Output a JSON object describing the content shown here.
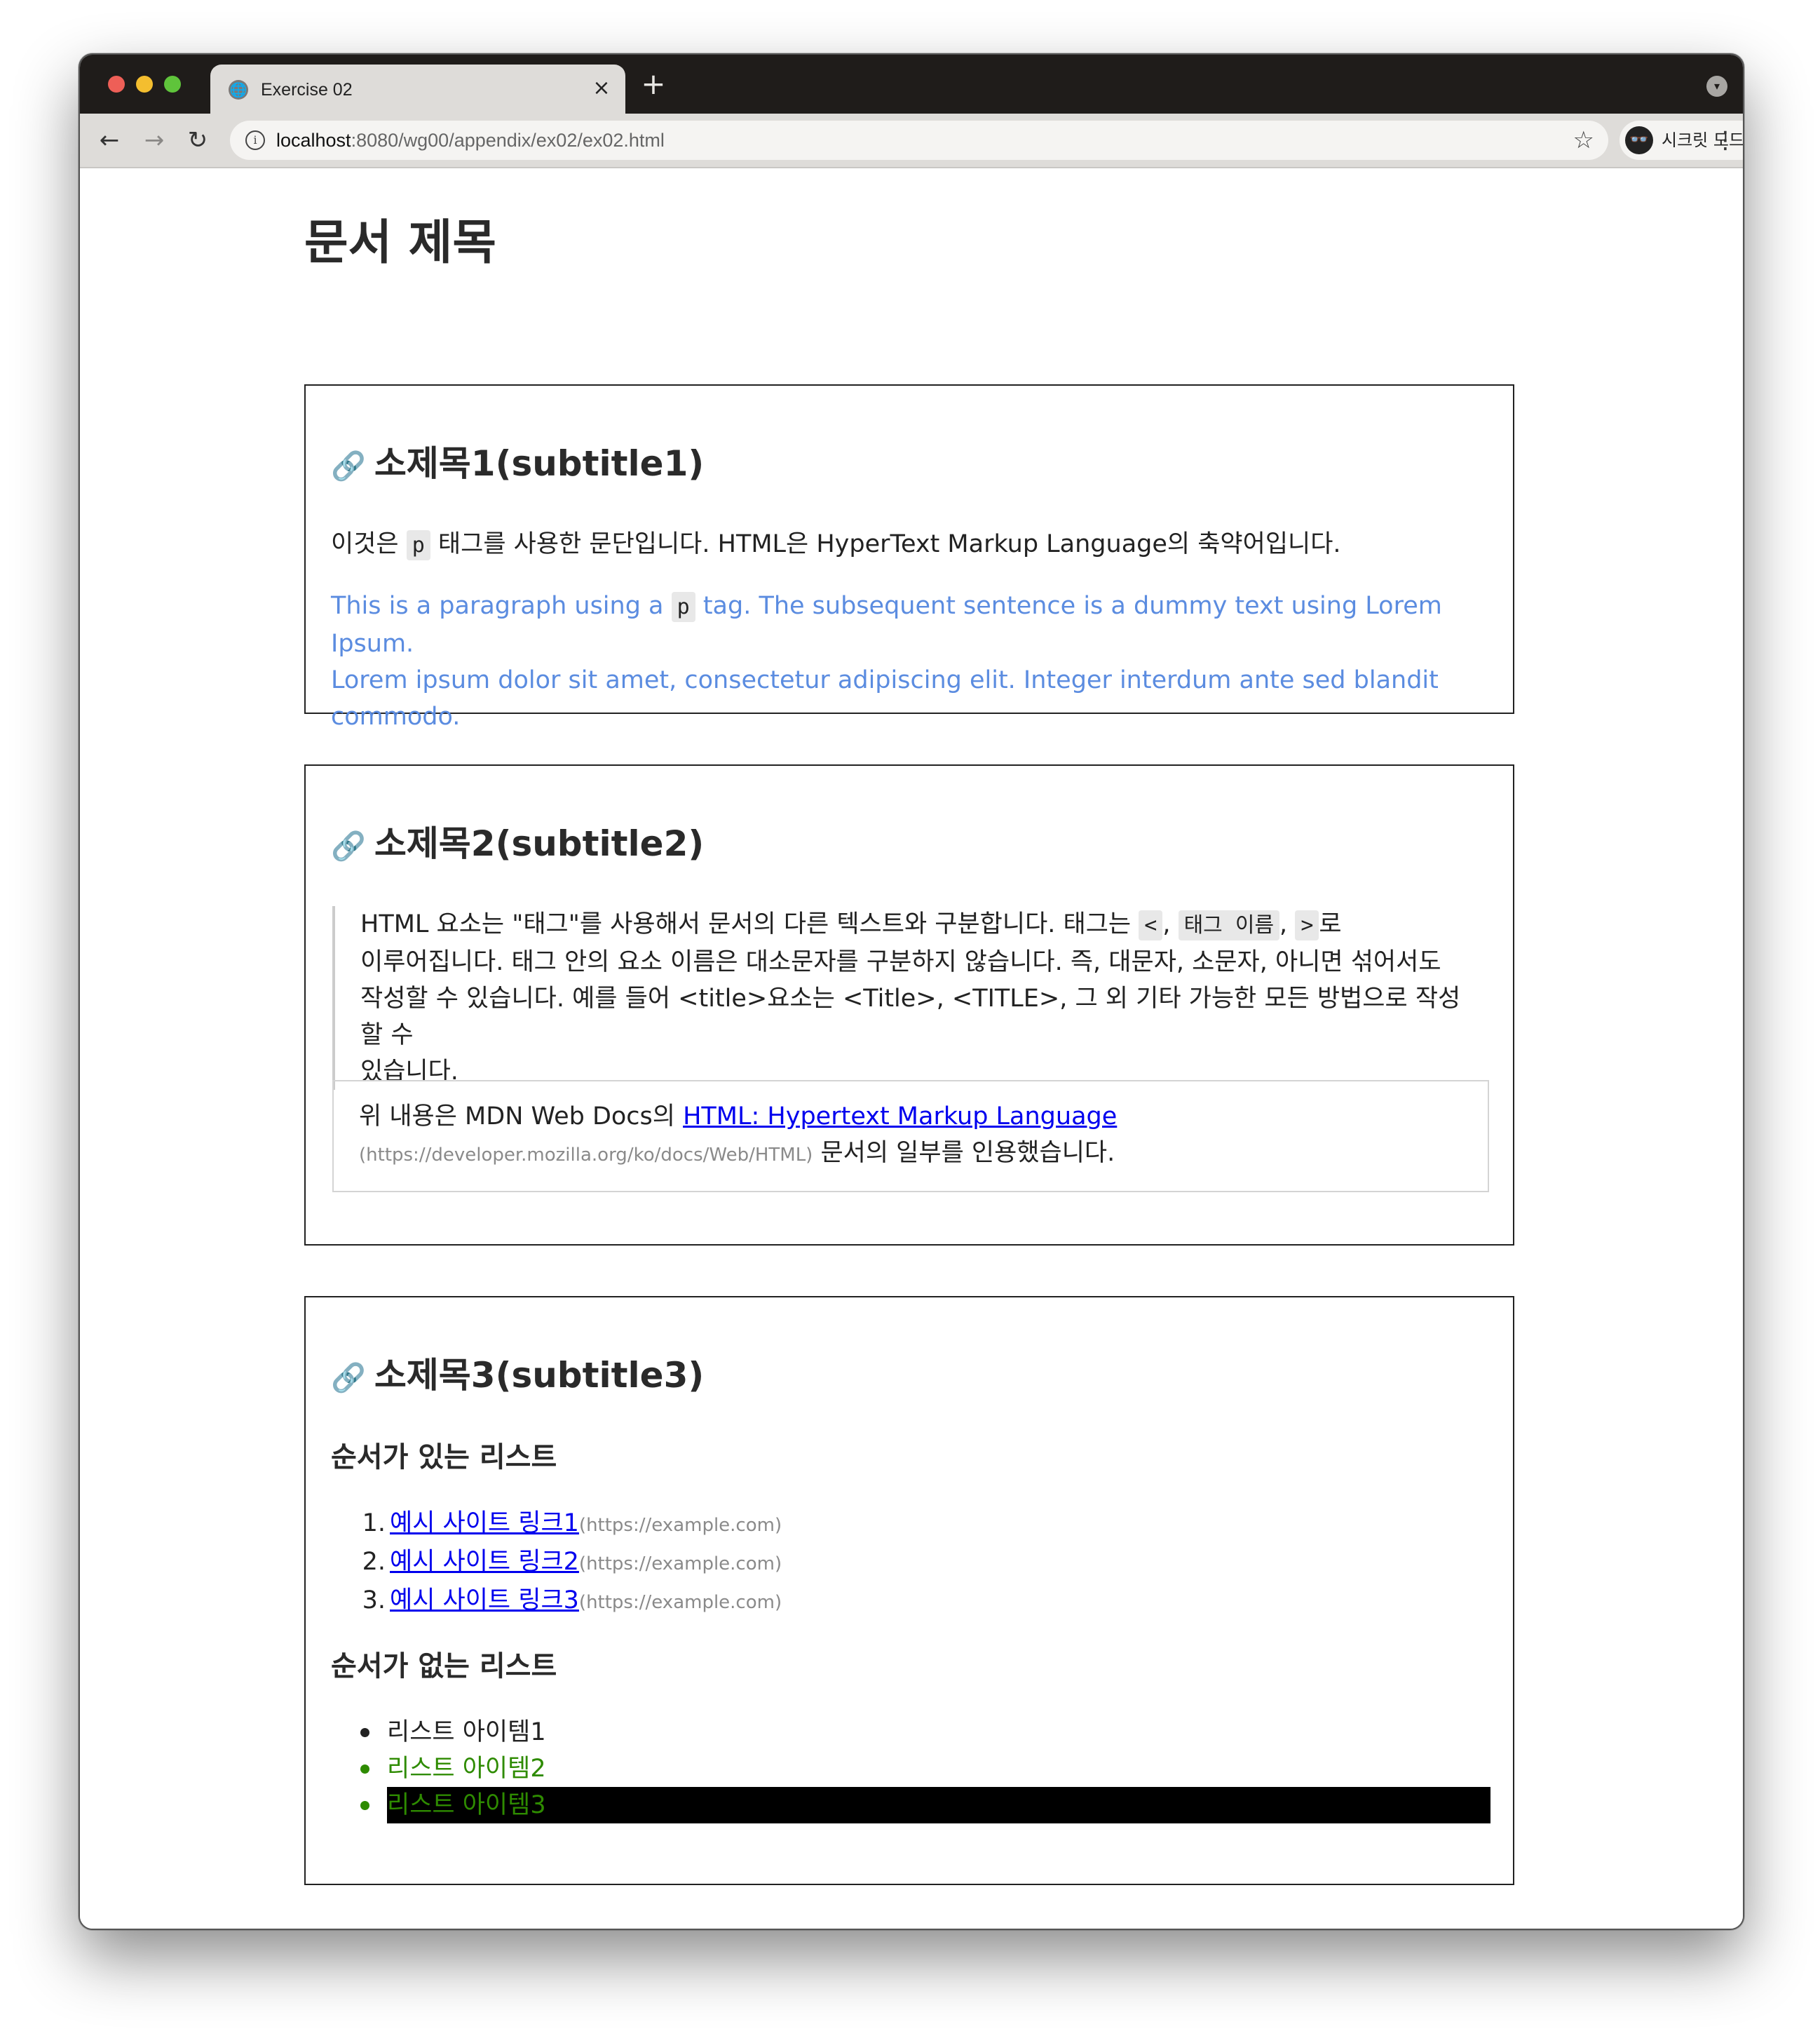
{
  "browser": {
    "tab_title": "Exercise 02",
    "tab_close": "×",
    "new_tab": "+",
    "url_host": "localhost",
    "url_path": ":8080/wg00/appendix/ex02/ex02.html",
    "incognito_label": "시크릿 모드",
    "icons": {
      "back": "←",
      "forward": "→",
      "reload": "↻",
      "star": "☆",
      "kebab": "⋮",
      "info": "i",
      "tab_menu": "▾",
      "incognito": "👓",
      "globe": "🌐"
    }
  },
  "page": {
    "title": "문서 제목",
    "link_icon": "🔗",
    "section1": {
      "heading": "소제목1(subtitle1)",
      "p1_before": "이것은 ",
      "p1_code": "p",
      "p1_after": " 태그를 사용한 문단입니다. HTML은 HyperText Markup Language의 축약어입니다.",
      "p2_before": "This is a paragraph using a ",
      "p2_code": "p",
      "p2_line1_after": " tag. The subsequent sentence is a dummy text using Lorem Ipsum.",
      "p2_line2": "Lorem ipsum dolor sit amet, consectetur adipiscing elit. Integer interdum ante sed blandit commodo."
    },
    "section2": {
      "heading": "소제목2(subtitle2)",
      "quote_line1_before": "HTML 요소는 \"태그\"를 사용해서 문서의 다른 텍스트와 구분합니다. 태그는 ",
      "code_lt": "<",
      "sep": ", ",
      "code_tagname": "태그 이름",
      "code_gt": ">",
      "quote_line1_after": "로",
      "quote_line2": "이루어집니다. 태그 안의 요소 이름은 대소문자를 구분하지 않습니다. 즉, 대문자, 소문자, 아니면 섞어서도",
      "quote_line3": "작성할 수 있습니다. 예를 들어 <title>요소는 <Title>, <TITLE>, 그 외 기타 가능한 모든 방법으로 작성할 수",
      "quote_line4": "있습니다.",
      "cite_before": "위 내용은 MDN Web Docs의 ",
      "cite_link": "HTML: Hypertext Markup Language",
      "cite_url": "(https://developer.mozilla.org/ko/docs/Web/HTML)",
      "cite_after": " 문서의 일부를 인용했습니다."
    },
    "section3": {
      "heading": "소제목3(subtitle3)",
      "ordered_heading": "순서가 있는 리스트",
      "ordered_items": [
        {
          "num": "1.",
          "label": "예시 사이트 링크1",
          "url": "(https://example.com)"
        },
        {
          "num": "2.",
          "label": "예시 사이트 링크2",
          "url": "(https://example.com)"
        },
        {
          "num": "3.",
          "label": "예시 사이트 링크3",
          "url": "(https://example.com)"
        }
      ],
      "unordered_heading": "순서가 없는 리스트",
      "unordered_items": [
        "리스트 아이템1",
        "리스트 아이템2",
        "리스트 아이템3"
      ]
    }
  },
  "colors": {
    "blue_text": "#5b8ce0",
    "green_text": "#2e8b00",
    "link": "#0000ee",
    "highlight_bg": "#000000"
  }
}
